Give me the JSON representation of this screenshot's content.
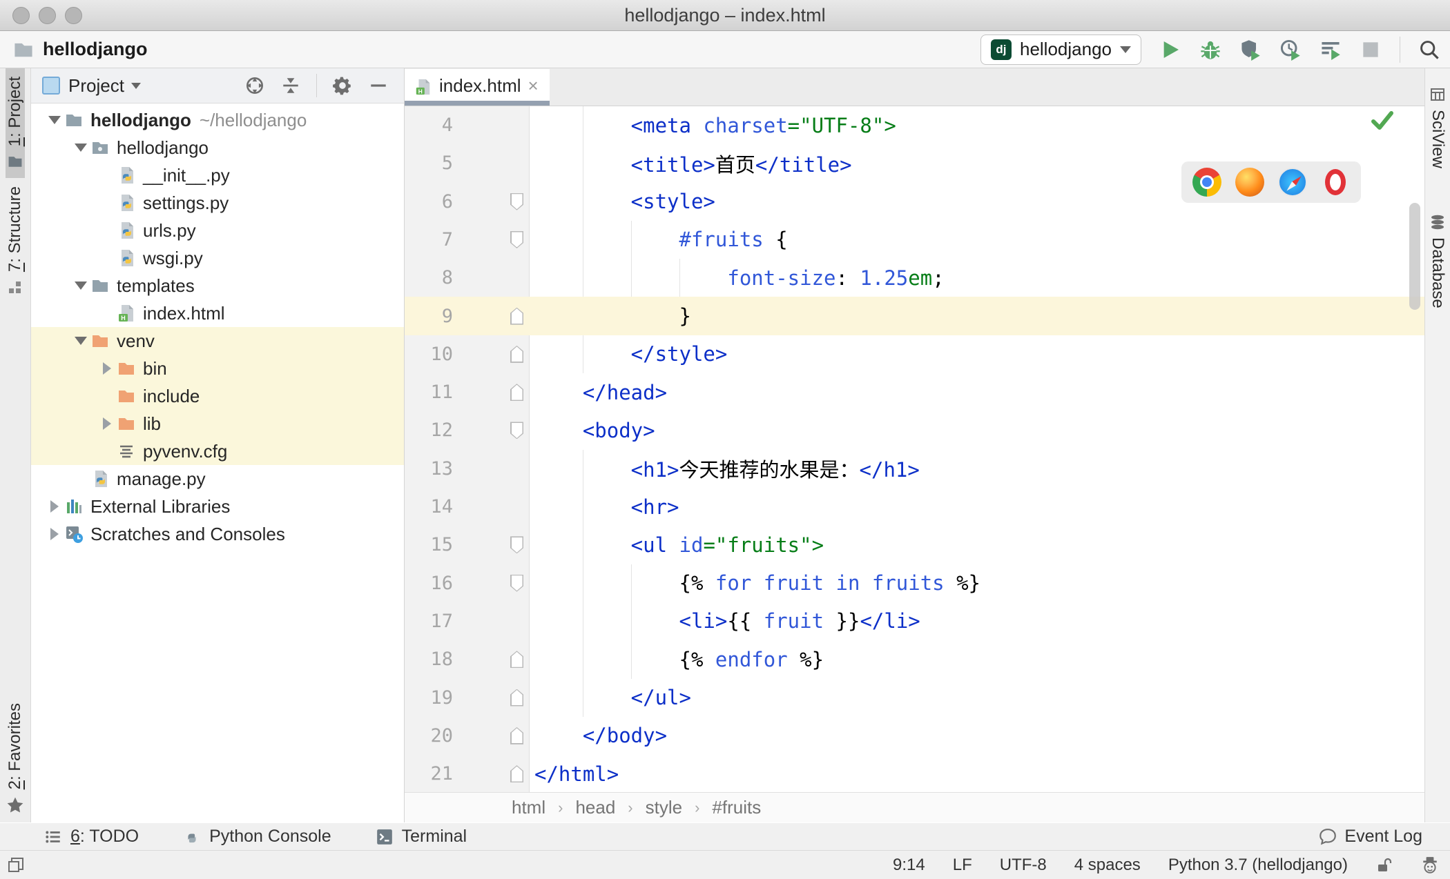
{
  "window": {
    "title": "hellodjango – index.html"
  },
  "toolbar": {
    "project_crumb": "hellodjango",
    "run_config": {
      "badge": "dj",
      "name": "hellodjango"
    }
  },
  "left_stripe": {
    "project": {
      "num": "1",
      "rest": ": Project"
    },
    "structure": {
      "num": "7",
      "rest": ": Structure"
    },
    "favorites": {
      "num": "2",
      "rest": ": Favorites"
    }
  },
  "project_panel": {
    "title": "Project",
    "tree": {
      "items": [
        {
          "label": "hellodjango",
          "suffix": "~/hellodjango"
        },
        {
          "label": "hellodjango"
        },
        {
          "label": "__init__.py"
        },
        {
          "label": "settings.py"
        },
        {
          "label": "urls.py"
        },
        {
          "label": "wsgi.py"
        },
        {
          "label": "templates"
        },
        {
          "label": "index.html"
        },
        {
          "label": "venv"
        },
        {
          "label": "bin"
        },
        {
          "label": "include"
        },
        {
          "label": "lib"
        },
        {
          "label": "pyvenv.cfg"
        },
        {
          "label": "manage.py"
        },
        {
          "label": "External Libraries"
        },
        {
          "label": "Scratches and Consoles"
        }
      ]
    }
  },
  "editor": {
    "tab": "index.html",
    "breadcrumbs": [
      "html",
      "head",
      "style",
      "#fruits"
    ],
    "lines": [
      {
        "num": "4",
        "segments": [
          {
            "t": "        <meta ",
            "c": "tg"
          },
          {
            "t": "charset",
            "c": "at"
          },
          {
            "t": "=\"UTF-8\">",
            "c": "st"
          }
        ]
      },
      {
        "num": "5",
        "segments": [
          {
            "t": "        <title>",
            "c": "tg"
          },
          {
            "t": "首页",
            "c": "pl"
          },
          {
            "t": "</title>",
            "c": "tg"
          }
        ]
      },
      {
        "num": "6",
        "segments": [
          {
            "t": "        <style>",
            "c": "tg"
          }
        ]
      },
      {
        "num": "7",
        "segments": [
          {
            "t": "            ",
            "c": "pl"
          },
          {
            "t": "#fruits",
            "c": "at"
          },
          {
            "t": " {",
            "c": "pl"
          }
        ]
      },
      {
        "num": "8",
        "segments": [
          {
            "t": "                ",
            "c": "pl"
          },
          {
            "t": "font-size",
            "c": "at"
          },
          {
            "t": ": ",
            "c": "pl"
          },
          {
            "t": "1.25",
            "c": "at"
          },
          {
            "t": "em",
            "c": "st"
          },
          {
            "t": ";",
            "c": "pl"
          }
        ]
      },
      {
        "num": "9",
        "segments": [
          {
            "t": "            }",
            "c": "pl"
          }
        ]
      },
      {
        "num": "10",
        "segments": [
          {
            "t": "        </style>",
            "c": "tg"
          }
        ]
      },
      {
        "num": "11",
        "segments": [
          {
            "t": "    </head>",
            "c": "tg"
          }
        ]
      },
      {
        "num": "12",
        "segments": [
          {
            "t": "    <body>",
            "c": "tg"
          }
        ]
      },
      {
        "num": "13",
        "segments": [
          {
            "t": "        <h1>",
            "c": "tg"
          },
          {
            "t": "今天推荐的水果是：",
            "c": "pl"
          },
          {
            "t": "</h1>",
            "c": "tg"
          }
        ]
      },
      {
        "num": "14",
        "segments": [
          {
            "t": "        <hr>",
            "c": "tg"
          }
        ]
      },
      {
        "num": "15",
        "segments": [
          {
            "t": "        <ul ",
            "c": "tg"
          },
          {
            "t": "id",
            "c": "at"
          },
          {
            "t": "=\"fruits\">",
            "c": "st"
          }
        ]
      },
      {
        "num": "16",
        "segments": [
          {
            "t": "            {% ",
            "c": "pl"
          },
          {
            "t": "for fruit in fruits",
            "c": "at"
          },
          {
            "t": " %}",
            "c": "pl"
          }
        ]
      },
      {
        "num": "17",
        "segments": [
          {
            "t": "            <li>",
            "c": "tg"
          },
          {
            "t": "{{ ",
            "c": "pl"
          },
          {
            "t": "fruit",
            "c": "at"
          },
          {
            "t": " }}",
            "c": "pl"
          },
          {
            "t": "</li>",
            "c": "tg"
          }
        ]
      },
      {
        "num": "18",
        "segments": [
          {
            "t": "            {% ",
            "c": "pl"
          },
          {
            "t": "endfor",
            "c": "at"
          },
          {
            "t": " %}",
            "c": "pl"
          }
        ]
      },
      {
        "num": "19",
        "segments": [
          {
            "t": "        </ul>",
            "c": "tg"
          }
        ]
      },
      {
        "num": "20",
        "segments": [
          {
            "t": "    </body>",
            "c": "tg"
          }
        ]
      },
      {
        "num": "21",
        "segments": [
          {
            "t": "</html>",
            "c": "tg"
          }
        ]
      }
    ]
  },
  "right_stripe": {
    "sciview": "SciView",
    "database": "Database"
  },
  "bottom_bar": {
    "todo": {
      "num": "6",
      "rest": ": TODO"
    },
    "python_console": "Python Console",
    "terminal": "Terminal",
    "event_log": "Event Log"
  },
  "status_bar": {
    "caret": "9:14",
    "line_ending": "LF",
    "encoding": "UTF-8",
    "indent": "4 spaces",
    "interpreter": "Python 3.7 (hellodjango)"
  },
  "colors": {
    "tag_blue": "#0c2fc8",
    "attribute_blue": "#3157d8",
    "string_green": "#067d17",
    "run_green": "#59a869",
    "django_badge": "#0c4b33",
    "caret_line": "#fcf6db",
    "tree_highlight": "#fbf7db",
    "tab_underline": "#94a0b0"
  }
}
